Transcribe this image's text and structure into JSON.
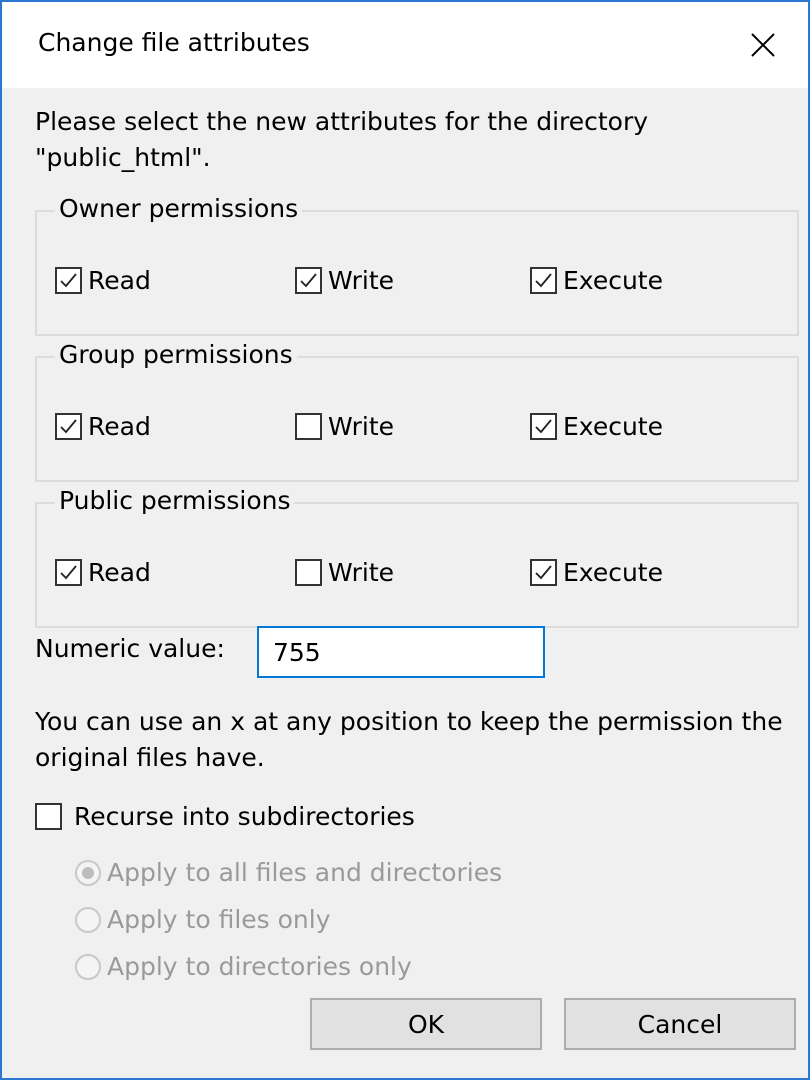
{
  "dialog": {
    "title": "Change file attributes",
    "description": "Please select the new attributes for the directory \"public_html\".",
    "groups": [
      {
        "label": "Owner permissions",
        "read": "Read",
        "write": "Write",
        "execute": "Execute",
        "read_checked": true,
        "write_checked": true,
        "execute_checked": true
      },
      {
        "label": "Group permissions",
        "read": "Read",
        "write": "Write",
        "execute": "Execute",
        "read_checked": true,
        "write_checked": false,
        "execute_checked": true
      },
      {
        "label": "Public permissions",
        "read": "Read",
        "write": "Write",
        "execute": "Execute",
        "read_checked": true,
        "write_checked": false,
        "execute_checked": true
      }
    ],
    "numeric_label": "Numeric value:",
    "numeric_value": "755",
    "hint": "You can use an x at any position to keep the permission the original files have.",
    "recurse_label": "Recurse into subdirectories",
    "recurse_checked": false,
    "apply_options": [
      {
        "label": "Apply to all files and directories",
        "selected": true
      },
      {
        "label": "Apply to files only",
        "selected": false
      },
      {
        "label": "Apply to directories only",
        "selected": false
      }
    ],
    "ok_label": "OK",
    "cancel_label": "Cancel"
  },
  "colors": {
    "accent": "#0078d7",
    "window_border": "#2b78d4",
    "disabled_text": "#9a9a9a"
  }
}
